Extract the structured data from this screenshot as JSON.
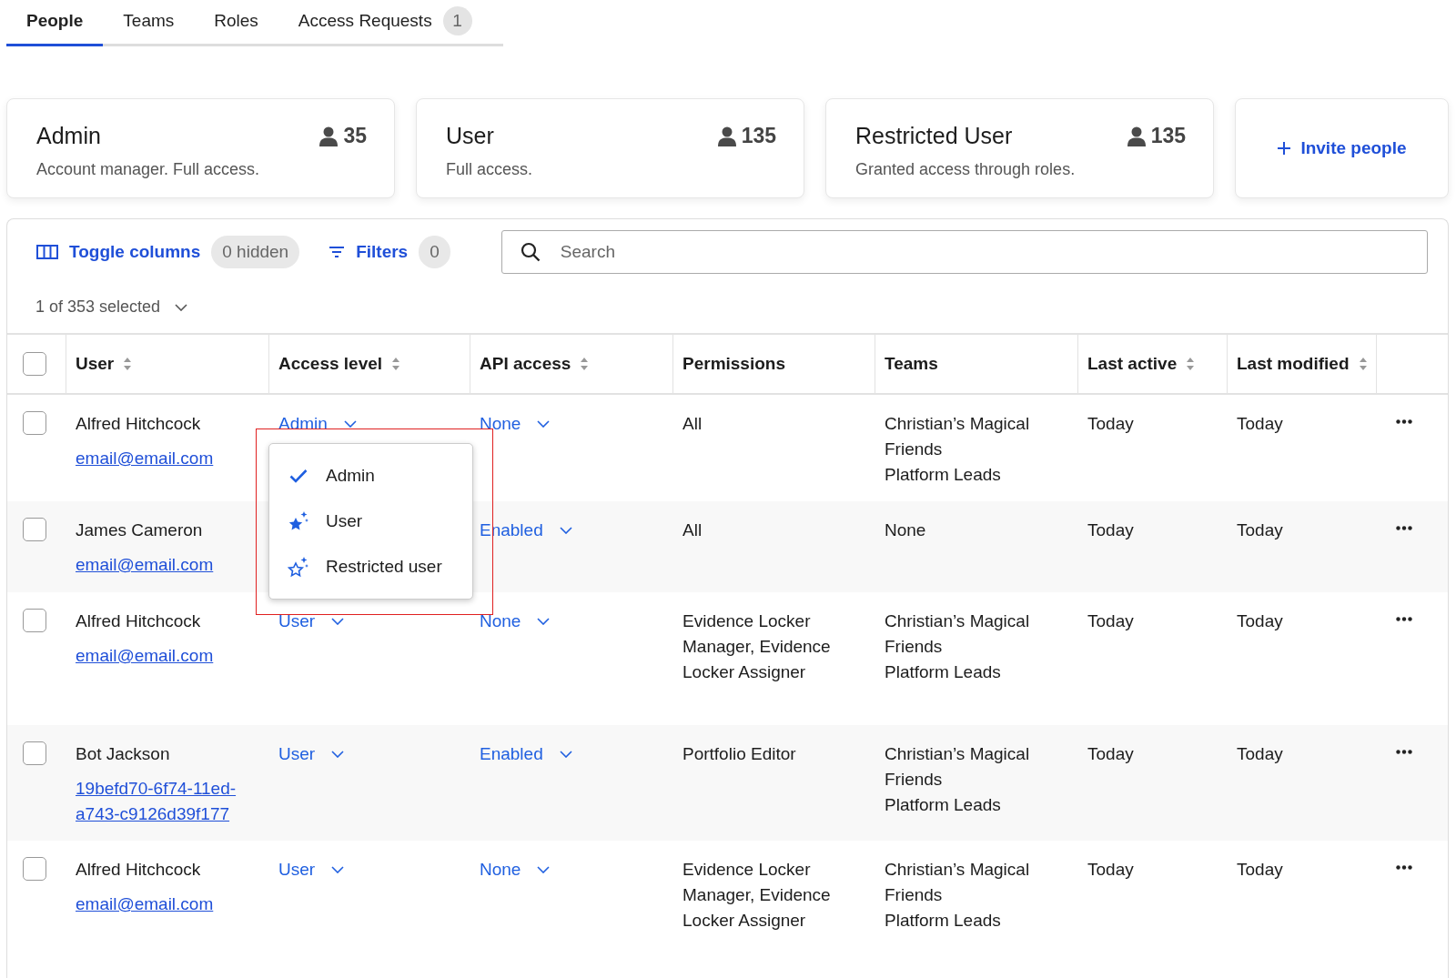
{
  "tabs": [
    {
      "label": "People",
      "selected": true
    },
    {
      "label": "Teams",
      "selected": false
    },
    {
      "label": "Roles",
      "selected": false
    },
    {
      "label": "Access Requests",
      "selected": false,
      "badge": "1"
    }
  ],
  "role_cards": [
    {
      "title": "Admin",
      "count": "35",
      "description": "Account manager. Full access."
    },
    {
      "title": "User",
      "count": "135",
      "description": "Full access."
    },
    {
      "title": "Restricted User",
      "count": "135",
      "description": "Granted access through roles."
    }
  ],
  "invite_button": {
    "label": "Invite people"
  },
  "toolbar": {
    "toggle_columns": "Toggle columns",
    "hidden_badge": "0 hidden",
    "filters": "Filters",
    "filters_badge": "0",
    "search": {
      "placeholder": "Search"
    },
    "selection": "1 of 353 selected"
  },
  "table": {
    "header_checkbox": {
      "checked": false
    },
    "columns": [
      {
        "label": "User",
        "sortable": true
      },
      {
        "label": "Access level",
        "sortable": true
      },
      {
        "label": "API access",
        "sortable": true
      },
      {
        "label": "Permissions",
        "sortable": false
      },
      {
        "label": "Teams",
        "sortable": false
      },
      {
        "label": "Last active",
        "sortable": true
      },
      {
        "label": "Last modified",
        "sortable": true
      }
    ],
    "rows": [
      {
        "checked": false,
        "name": "Alfred Hitchcock",
        "link": "email@email.com",
        "access_level": "Admin",
        "api_access": "None",
        "permissions": "All",
        "teams": [
          "Christian’s Magical Friends",
          "Platform Leads"
        ],
        "last_active": "Today",
        "last_modified": "Today"
      },
      {
        "checked": false,
        "name": "James Cameron",
        "link": "email@email.com",
        "api_access": "Enabled",
        "permissions": "All",
        "teams": [
          "None"
        ],
        "last_active": "Today",
        "last_modified": "Today"
      },
      {
        "checked": false,
        "name": "Alfred Hitchcock",
        "link": "email@email.com",
        "access_level": "User",
        "api_access": "None",
        "permissions": "Evidence Locker Manager, Evidence Locker Assigner",
        "teams": [
          "Christian’s Magical Friends",
          "Platform Leads"
        ],
        "last_active": "Today",
        "last_modified": "Today"
      },
      {
        "checked": false,
        "name": "Bot Jackson",
        "link": "19befd70-6f74-11ed-a743-c9126d39f177",
        "access_level": "User",
        "api_access": "Enabled",
        "permissions": "Portfolio Editor",
        "teams": [
          "Christian’s Magical Friends",
          "Platform Leads"
        ],
        "last_active": "Today",
        "last_modified": "Today"
      },
      {
        "checked": false,
        "name": "Alfred Hitchcock",
        "link": "email@email.com",
        "access_level": "User",
        "api_access": "None",
        "permissions": "Evidence Locker Manager, Evidence Locker Assigner",
        "teams": [
          "Christian’s Magical Friends",
          "Platform Leads"
        ],
        "last_active": "Today",
        "last_modified": "Today"
      }
    ]
  },
  "access_menu": {
    "items": [
      {
        "label": "Admin",
        "kind": "check"
      },
      {
        "label": "User",
        "kind": "star-filled"
      },
      {
        "label": "Restricted user",
        "kind": "star-outline"
      }
    ]
  }
}
